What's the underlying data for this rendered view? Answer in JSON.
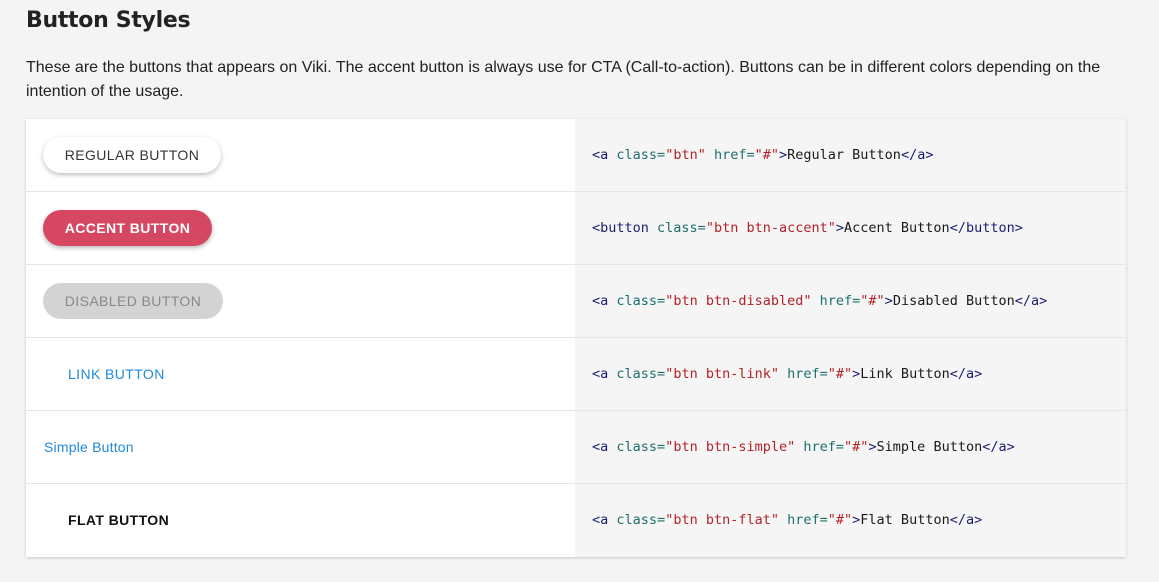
{
  "page": {
    "title": "Button Styles",
    "description": "These are the buttons that appears on Viki. The accent button is always use for CTA (Call-to-action). Buttons can be in different colors depending on the intention of the usage."
  },
  "colors": {
    "accent": "#d64763",
    "link": "#1f8ad8",
    "disabled_bg": "#d3d3d3"
  },
  "rows": [
    {
      "button_label": "REGULAR BUTTON",
      "code": {
        "open_tag": "<a",
        "attr1": "class=",
        "val1": "\"btn\"",
        "attr2": "href=",
        "val2": "\"#\"",
        "close1": ">",
        "text": "Regular Button",
        "close_tag": "</a>"
      }
    },
    {
      "button_label": "ACCENT BUTTON",
      "code": {
        "open_tag": "<button",
        "attr1": "class=",
        "val1": "\"btn btn-accent\"",
        "close1": ">",
        "text": "Accent Button",
        "close_tag": "</button>"
      }
    },
    {
      "button_label": "DISABLED BUTTON",
      "code": {
        "open_tag": "<a",
        "attr1": "class=",
        "val1": "\"btn btn-disabled\"",
        "attr2": "href=",
        "val2": "\"#\"",
        "close1": ">",
        "text": "Disabled Button",
        "close_tag": "</a>"
      }
    },
    {
      "button_label": "LINK BUTTON",
      "code": {
        "open_tag": "<a",
        "attr1": "class=",
        "val1": "\"btn btn-link\"",
        "attr2": "href=",
        "val2": "\"#\"",
        "close1": ">",
        "text": "Link Button",
        "close_tag": "</a>"
      }
    },
    {
      "button_label": "Simple Button",
      "code": {
        "open_tag": "<a",
        "attr1": "class=",
        "val1": "\"btn btn-simple\"",
        "attr2": "href=",
        "val2": "\"#\"",
        "close1": ">",
        "text": "Simple Button",
        "close_tag": "</a>"
      }
    },
    {
      "button_label": "FLAT BUTTON",
      "code": {
        "open_tag": "<a",
        "attr1": "class=",
        "val1": "\"btn btn-flat\"",
        "attr2": "href=",
        "val2": "\"#\"",
        "close1": ">",
        "text": "Flat Button",
        "close_tag": "</a>"
      }
    }
  ]
}
